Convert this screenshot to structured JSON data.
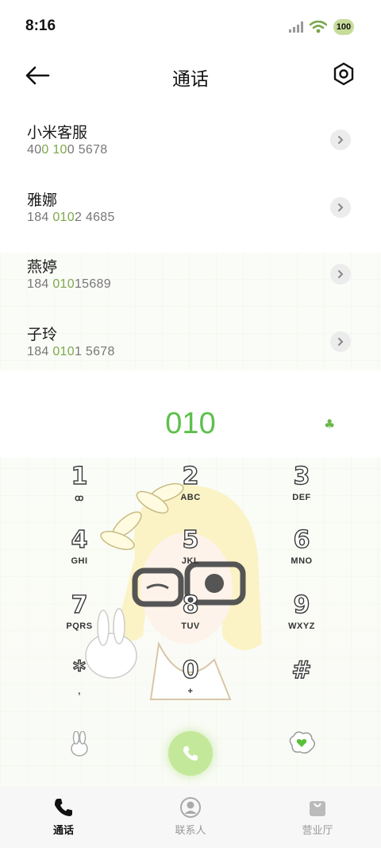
{
  "status": {
    "time": "8:16",
    "battery": "100"
  },
  "header": {
    "title": "通话"
  },
  "contacts": [
    {
      "name": "小米客服",
      "num_pre": "40",
      "num_hl": "0 10",
      "num_post": "0 5678"
    },
    {
      "name": "雅娜",
      "num_pre": "184 ",
      "num_hl": "010",
      "num_post": "2 4685"
    },
    {
      "name": "燕婷",
      "num_pre": "184 ",
      "num_hl": "010",
      "num_post": "15689"
    },
    {
      "name": "子玲",
      "num_pre": "184 ",
      "num_hl": "010",
      "num_post": "1 5678"
    }
  ],
  "dialed": "010",
  "keys": [
    {
      "digit": "1",
      "letters": "ꝏ"
    },
    {
      "digit": "2",
      "letters": "ABC"
    },
    {
      "digit": "3",
      "letters": "DEF"
    },
    {
      "digit": "4",
      "letters": "GHI"
    },
    {
      "digit": "5",
      "letters": "JKL"
    },
    {
      "digit": "6",
      "letters": "MNO"
    },
    {
      "digit": "7",
      "letters": "PQRS"
    },
    {
      "digit": "8",
      "letters": "TUV"
    },
    {
      "digit": "9",
      "letters": "WXYZ"
    },
    {
      "digit": "*",
      "letters": ","
    },
    {
      "digit": "0",
      "letters": "+"
    },
    {
      "digit": "#",
      "letters": ""
    }
  ],
  "nav": [
    {
      "label": "通话",
      "icon": "phone-icon"
    },
    {
      "label": "联系人",
      "icon": "person-icon"
    },
    {
      "label": "营业厅",
      "icon": "bag-icon"
    }
  ],
  "colors": {
    "accent": "#5cc04a",
    "highlight": "#7ea84c",
    "call_button": "#c4e89a"
  }
}
